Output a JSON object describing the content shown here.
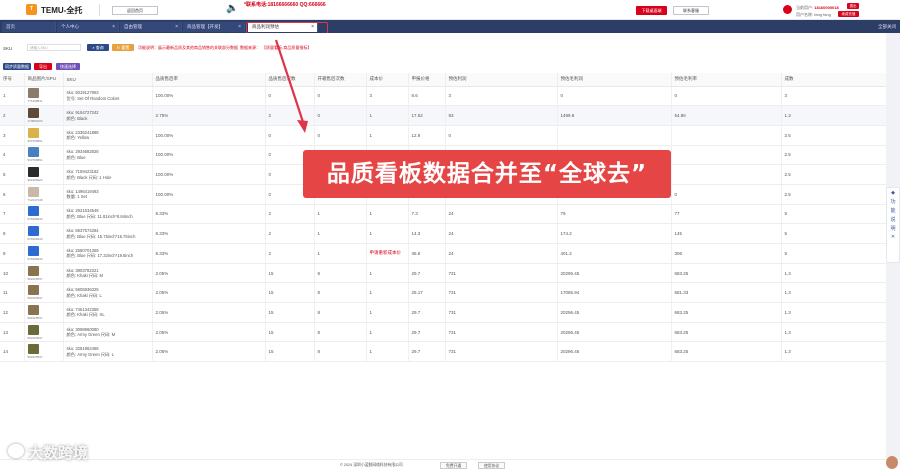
{
  "header": {
    "logo_text": "TEMU-全托",
    "home_label": "返回首页",
    "banner_red": "*联系电话:18166666660 QQ:666666",
    "banner_grey": "https://www.dashuju.com",
    "download_label": "下载桌面端",
    "share_label": "联系客服",
    "user_phone_label": "当前用户:",
    "user_phone": "18160000018",
    "user_name_label": "用户名称:",
    "user_name": "fang fang",
    "badge1": "退出",
    "badge2": "续费充值"
  },
  "tabs": [
    {
      "label": "首页"
    },
    {
      "label": "个人中心"
    },
    {
      "label": "自由管理"
    },
    {
      "label": "商品管理【开发】"
    },
    {
      "label": "商品利润预估"
    }
  ],
  "tabs_right": "全部关闭",
  "toolbar": {
    "filter_label": "SKU",
    "select_value": "SKU",
    "input_placeholder": "请输入SKU",
    "search_label": "查询",
    "reset_label": "重置",
    "note1": "功能说明：展示最新品质及其他商品销售的关联部分数据",
    "note2": "数据来源：",
    "note3": "【质量看板-商品质量指标】",
    "sync_label": "同步质量数据",
    "export_label": "导出",
    "fast_label": "快速选择"
  },
  "columns": [
    "序号",
    "商品图片/SPU",
    "SKU",
    "品质售后率",
    "品质售后次数",
    "开箱售后次数",
    "成本价",
    "申报价格",
    "预估利润",
    "预估毛利润",
    "预估毛利率",
    "成数"
  ],
  "rows": [
    {
      "no": "1",
      "spu": "771468541",
      "sku": "6019127953",
      "attr": "货号: Set Of Random Colors",
      "rate": "100.00%",
      "q": "0",
      "o": "0",
      "cost": "3",
      "price": "8.6",
      "p": "3",
      "gp": "0",
      "gm": "0",
      "n": "3",
      "img": "#8a7b6a"
    },
    {
      "no": "2",
      "spu": "170896203",
      "sku": "9154727242",
      "attr": "颜色: Black",
      "rate": "2.75%",
      "q": "2",
      "o": "0",
      "cost": "1",
      "price": "17.62",
      "p": "93",
      "gp": "1499.8",
      "gm": "54.86",
      "n": "1.3",
      "img": "#5c4a3a"
    },
    {
      "no": "3",
      "spu": "503796891",
      "sku": "2335241888",
      "attr": "颜色: Yellow",
      "rate": "100.00%",
      "q": "0",
      "o": "0",
      "cost": "1",
      "price": "12.9",
      "p": "0",
      "gp": "",
      "gm": "",
      "n": "2.5",
      "img": "#d9b24a"
    },
    {
      "no": "4",
      "spu": "503796891",
      "sku": "2934682826",
      "attr": "颜色: Blue",
      "rate": "100.00%",
      "q": "0",
      "o": "0",
      "cost": "1",
      "price": "12.9",
      "p": "0",
      "gp": "",
      "gm": "",
      "n": "2.5",
      "img": "#4a7fc1"
    },
    {
      "no": "5",
      "spu": "961958422",
      "sku": "7159423162",
      "attr": "颜色: Black 尺码: 1 Hole",
      "rate": "100.00%",
      "q": "0",
      "o": "0",
      "cost": "22",
      "price": "15.66",
      "p": "0",
      "gp": "",
      "gm": "",
      "n": "2.5",
      "img": "#2a2a2a"
    },
    {
      "no": "6",
      "spu": "712247448",
      "sku": "1496419493",
      "attr": "数量: 1 Set",
      "rate": "100.00%",
      "q": "0",
      "o": "0",
      "cost": "1",
      "price": "8.76",
      "p": "0",
      "gp": "0",
      "gm": "0",
      "n": "2.5",
      "img": "#c8b8a8"
    },
    {
      "no": "7",
      "spu": "615398442",
      "sku": "2921534549",
      "attr": "颜色: Blue 尺码: 11.81inch*9.84inch",
      "rate": "8.33%",
      "q": "2",
      "o": "1",
      "cost": "1",
      "price": "7.3",
      "p": "24",
      "gp": "79",
      "gm": "77",
      "n": "5",
      "img": "#2d6bd1"
    },
    {
      "no": "8",
      "spu": "615398443",
      "sku": "6637574284",
      "attr": "颜色: Blue 尺码: 15.75inch*15.75inch",
      "rate": "8.33%",
      "q": "2",
      "o": "1",
      "cost": "1",
      "price": "14.3",
      "p": "24",
      "gp": "174.2",
      "gm": "145",
      "n": "5",
      "img": "#2d6bd1"
    },
    {
      "no": "9",
      "spu": "615398442",
      "sku": "2580701359",
      "attr": "颜色: Blue 尺码: 17.32inch*19.5inch",
      "rate": "8.33%",
      "q": "2",
      "o": "1",
      "cost": "申请重新成本价",
      "price": "36.8",
      "p": "24",
      "gp": "401.2",
      "gm": "306",
      "n": "5",
      "img": "#2d6bd1",
      "costRed": true
    },
    {
      "no": "10",
      "spu": "582425537",
      "sku": "3903782321",
      "attr": "颜色: Khaki 尺码: M",
      "rate": "2.05%",
      "q": "15",
      "o": "8",
      "cost": "1",
      "price": "29.7",
      "p": "731",
      "gp": "20296.45",
      "gm": "683.25",
      "n": "1.3",
      "img": "#8a7450"
    },
    {
      "no": "11",
      "spu": "582425537",
      "sku": "5605936325",
      "attr": "颜色: Khaki 尺码: L",
      "rate": "2.05%",
      "q": "15",
      "o": "8",
      "cost": "1",
      "price": "25.17",
      "p": "731",
      "gp": "17086.94",
      "gm": "581.33",
      "n": "1.3",
      "img": "#8a7450"
    },
    {
      "no": "12",
      "spu": "582425537",
      "sku": "7451342358",
      "attr": "颜色: Khaki 尺码: XL",
      "rate": "2.05%",
      "q": "15",
      "o": "8",
      "cost": "1",
      "price": "29.7",
      "p": "731",
      "gp": "20296.45",
      "gm": "683.25",
      "n": "1.3",
      "img": "#8a7450"
    },
    {
      "no": "13",
      "spu": "582425537",
      "sku": "3098960080",
      "attr": "颜色: Army Green 尺码: M",
      "rate": "2.05%",
      "q": "15",
      "o": "8",
      "cost": "1",
      "price": "29.7",
      "p": "731",
      "gp": "20296.45",
      "gm": "683.25",
      "n": "1.3",
      "img": "#6b6b3a"
    },
    {
      "no": "14",
      "spu": "582425537",
      "sku": "3281962466",
      "attr": "颜色: Army Green 尺码: L",
      "rate": "2.05%",
      "q": "15",
      "o": "8",
      "cost": "1",
      "price": "29.7",
      "p": "731",
      "gp": "20296.45",
      "gm": "683.25",
      "n": "1.3",
      "img": "#6b6b3a"
    }
  ],
  "overlay_text": "品质看板数据合并至“全球去”",
  "sidebar_items": [
    "◆",
    "功",
    "能",
    "说",
    "明",
    "✕"
  ],
  "footer": {
    "copyright": "© 2024 深圳小蓝鲸网络科技有限公司",
    "btn1": "免费开通",
    "btn2": "使用协议"
  },
  "watermark": "大数跨境"
}
